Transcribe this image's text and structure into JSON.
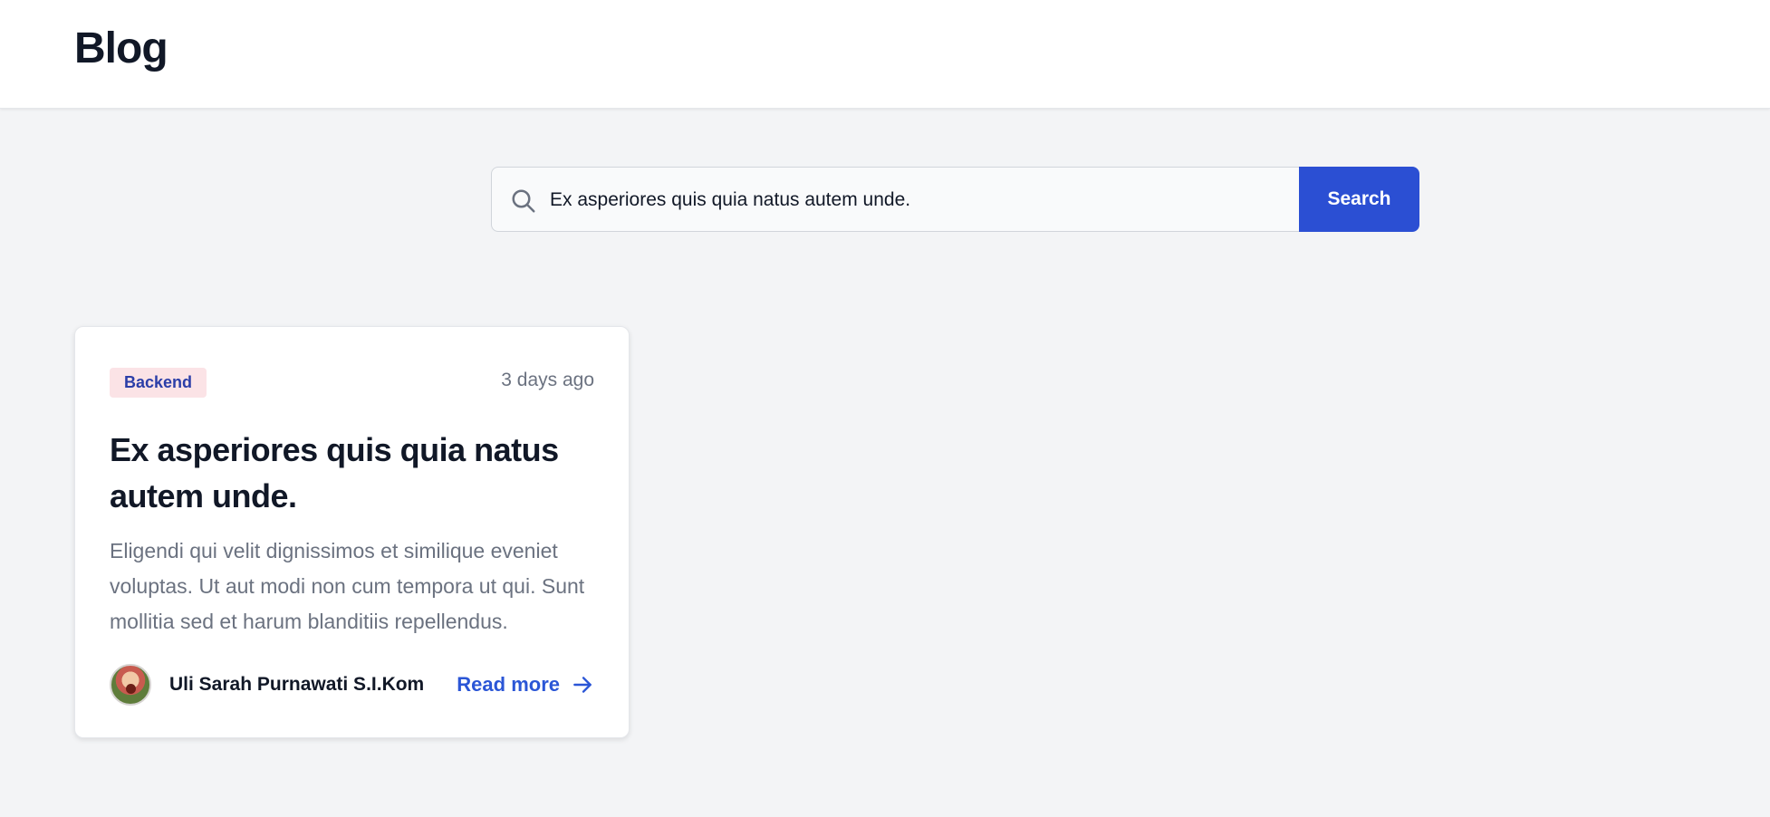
{
  "header": {
    "brand": "Blog"
  },
  "search": {
    "value": "Ex asperiores quis quia natus autem unde.",
    "placeholder": "Search",
    "button_label": "Search",
    "icon": "search-icon"
  },
  "colors": {
    "accent": "#2b4fd3",
    "tag_bg": "#fbe3e6",
    "tag_text": "#2b3ea8",
    "link": "#2b56d6"
  },
  "posts": [
    {
      "category": "Backend",
      "time_ago": "3 days ago",
      "title": "Ex asperiores quis quia natus autem unde.",
      "excerpt": "Eligendi qui velit dignissimos et similique eveniet voluptas. Ut aut modi non cum tempora ut qui. Sunt mollitia sed et harum blanditiis repellendus.",
      "author": "Uli Sarah Purnawati S.I.Kom",
      "read_more_label": "Read more",
      "read_more_icon": "arrow-right-icon"
    }
  ]
}
